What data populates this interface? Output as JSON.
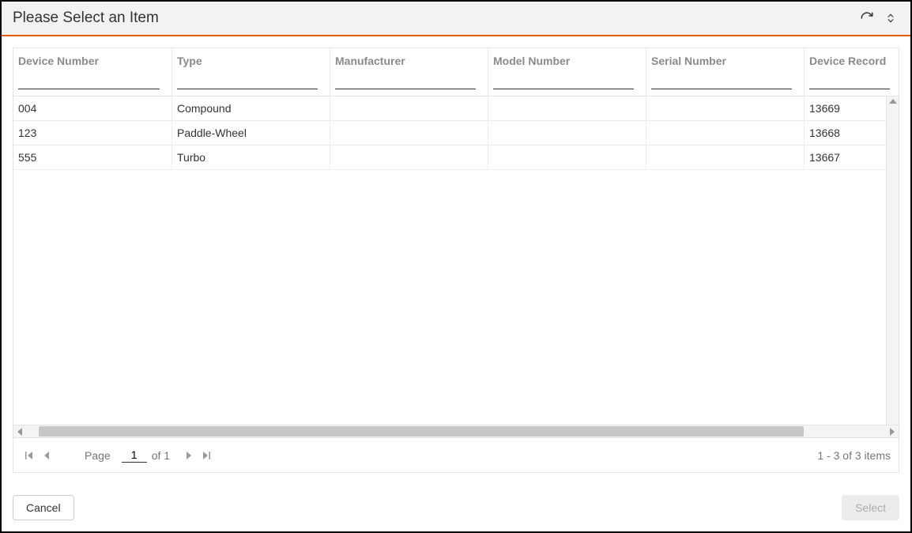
{
  "header": {
    "title": "Please Select an Item"
  },
  "grid": {
    "columns": [
      {
        "label": "Device Number"
      },
      {
        "label": "Type"
      },
      {
        "label": "Manufacturer"
      },
      {
        "label": "Model Number"
      },
      {
        "label": "Serial Number"
      },
      {
        "label": "Device Record"
      }
    ],
    "rows": [
      {
        "device_number": "004",
        "type": "Compound",
        "manufacturer": "",
        "model_number": "",
        "serial_number": "",
        "device_record": "13669"
      },
      {
        "device_number": "123",
        "type": "Paddle-Wheel",
        "manufacturer": "",
        "model_number": "",
        "serial_number": "",
        "device_record": "13668"
      },
      {
        "device_number": "555",
        "type": "Turbo",
        "manufacturer": "",
        "model_number": "",
        "serial_number": "",
        "device_record": "13667"
      }
    ]
  },
  "pager": {
    "page_label": "Page",
    "page_value": "1",
    "of_label": "of 1",
    "info": "1 - 3 of 3 items"
  },
  "footer": {
    "cancel_label": "Cancel",
    "select_label": "Select"
  }
}
